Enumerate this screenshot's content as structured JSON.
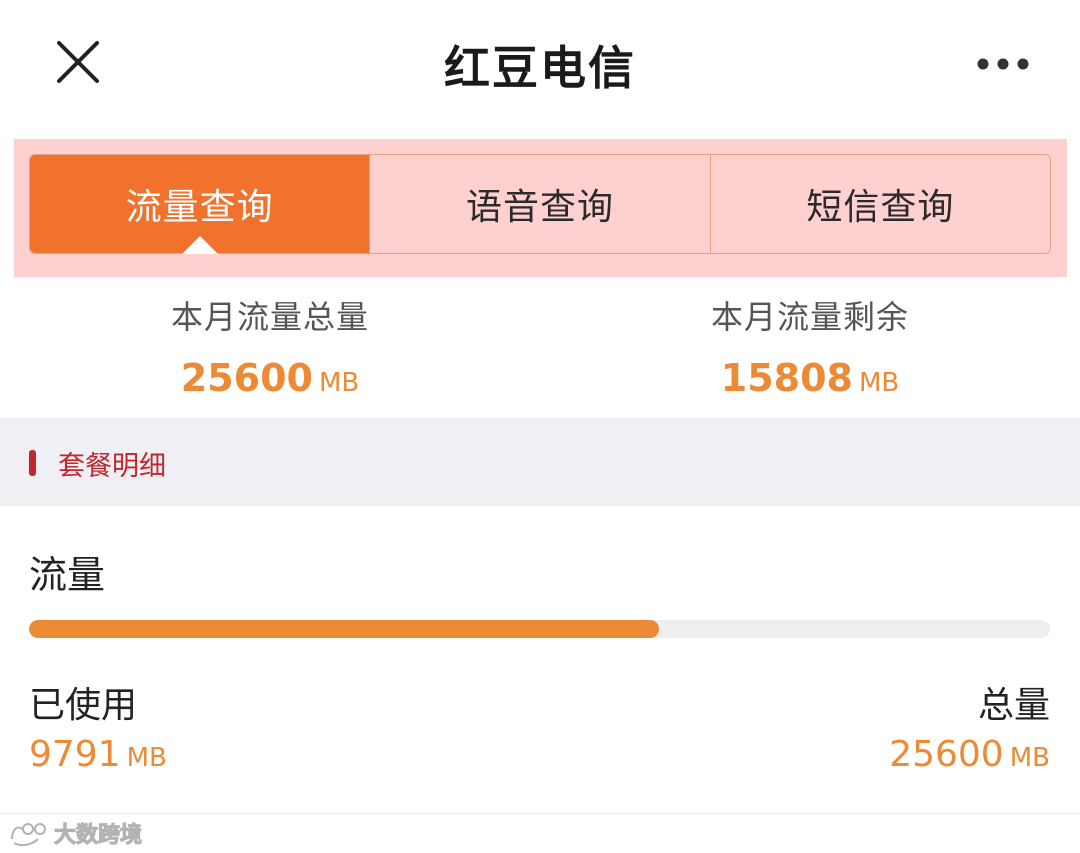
{
  "header": {
    "title": "红豆电信",
    "close_icon": "close-icon",
    "more_icon": "more-horizontal-icon"
  },
  "tabs": [
    {
      "label": "流量查询",
      "active": true
    },
    {
      "label": "语音查询",
      "active": false
    },
    {
      "label": "短信查询",
      "active": false
    }
  ],
  "summary": {
    "total": {
      "label": "本月流量总量",
      "value": "25600",
      "unit": "MB"
    },
    "remaining": {
      "label": "本月流量剩余",
      "value": "15808",
      "unit": "MB"
    }
  },
  "section": {
    "title": "套餐明细"
  },
  "detail": {
    "name": "流量",
    "used_label": "已使用",
    "used_value": "9791",
    "used_unit": "MB",
    "total_label": "总量",
    "total_value": "25600",
    "total_unit": "MB",
    "progress_fraction": 0.617
  },
  "watermark": {
    "text": "大数跨境"
  },
  "colors": {
    "accent": "#f0722c",
    "value_orange": "#ec8a35",
    "section_red": "#c1272d",
    "tab_band": "#ffd0d0",
    "section_bg": "#efeff4"
  }
}
